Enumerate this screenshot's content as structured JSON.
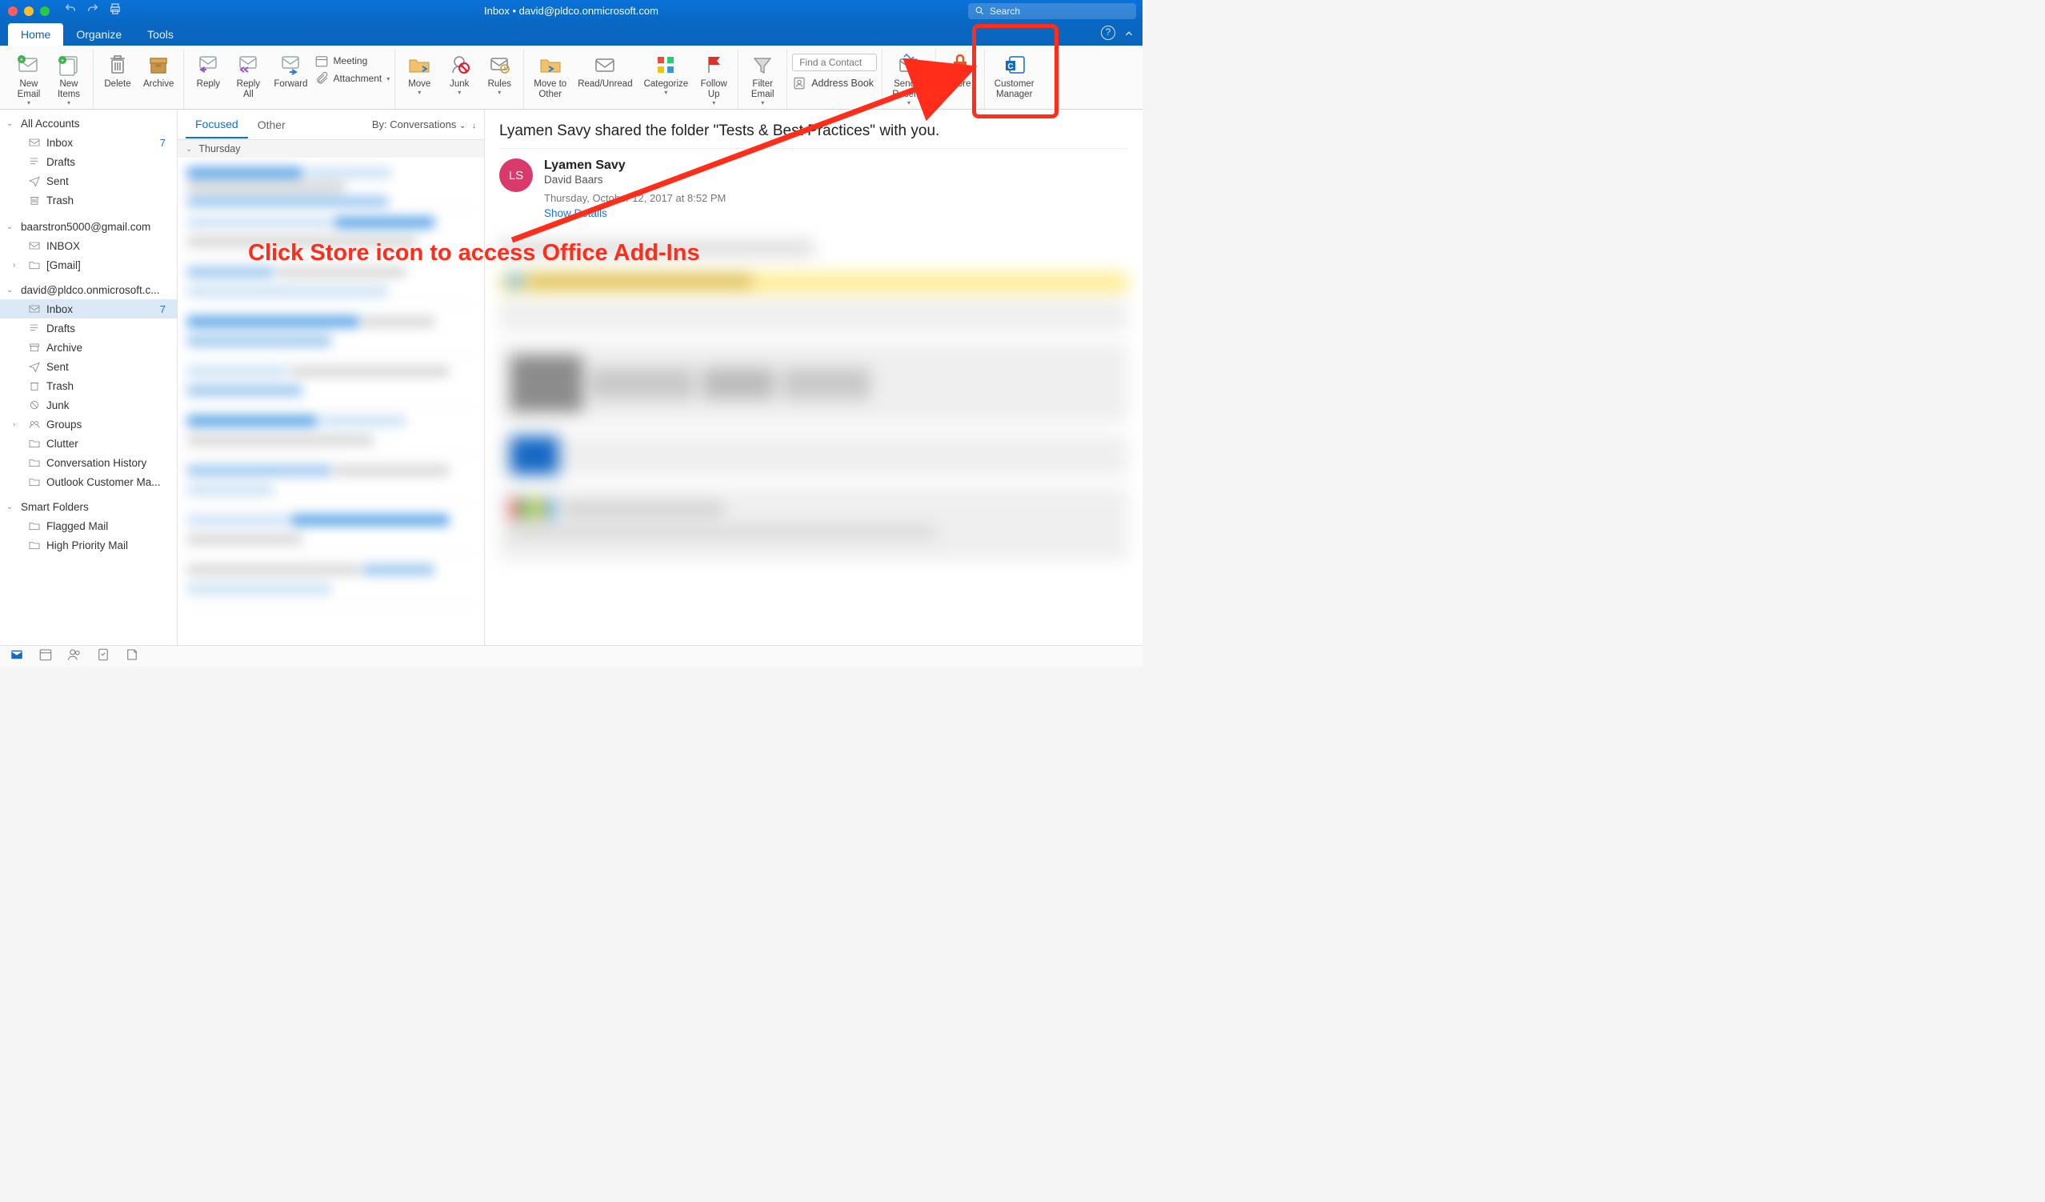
{
  "window_title": "Inbox • david@pldco.onmicrosoft.com",
  "search_placeholder": "Search",
  "tabs": {
    "home": "Home",
    "organize": "Organize",
    "tools": "Tools"
  },
  "ribbon": {
    "new_email": "New\nEmail",
    "new_items": "New\nItems",
    "delete": "Delete",
    "archive": "Archive",
    "reply": "Reply",
    "reply_all": "Reply\nAll",
    "forward": "Forward",
    "meeting": "Meeting",
    "attachment": "Attachment",
    "move": "Move",
    "junk": "Junk",
    "rules": "Rules",
    "move_other": "Move to\nOther",
    "read_unread": "Read/Unread",
    "categorize": "Categorize",
    "follow_up": "Follow\nUp",
    "filter_email": "Filter\nEmail",
    "find_contact_ph": "Find a Contact",
    "address_book": "Address Book",
    "send_receive": "Send &\nReceive",
    "store": "Store",
    "customer_mgr": "Customer\nManager"
  },
  "sidebar": {
    "all_accounts": "All Accounts",
    "inbox": "Inbox",
    "inbox_badge": "7",
    "drafts": "Drafts",
    "sent": "Sent",
    "trash": "Trash",
    "acct2": "baarstron5000@gmail.com",
    "acct2_inbox": "INBOX",
    "acct2_gmail": "[Gmail]",
    "acct3": "david@pldco.onmicrosoft.c...",
    "acct3_inbox": "Inbox",
    "acct3_inbox_badge": "7",
    "acct3_drafts": "Drafts",
    "acct3_archive": "Archive",
    "acct3_sent": "Sent",
    "acct3_trash": "Trash",
    "acct3_junk": "Junk",
    "acct3_groups": "Groups",
    "acct3_clutter": "Clutter",
    "acct3_convhist": "Conversation History",
    "acct3_ocm": "Outlook Customer Ma...",
    "smart": "Smart Folders",
    "flagged": "Flagged Mail",
    "highpri": "High Priority Mail"
  },
  "msglist": {
    "focused": "Focused",
    "other": "Other",
    "sort": "By: Conversations",
    "day_header": "Thursday"
  },
  "reading": {
    "subject": "Lyamen Savy shared the folder \"Tests & Best Practices\" with you.",
    "avatar_initials": "LS",
    "from": "Lyamen Savy",
    "to": "David Baars",
    "date": "Thursday, October 12, 2017 at 8:52 PM",
    "show_details": "Show Details"
  },
  "annotation": "Click Store icon to access Office Add-Ins"
}
